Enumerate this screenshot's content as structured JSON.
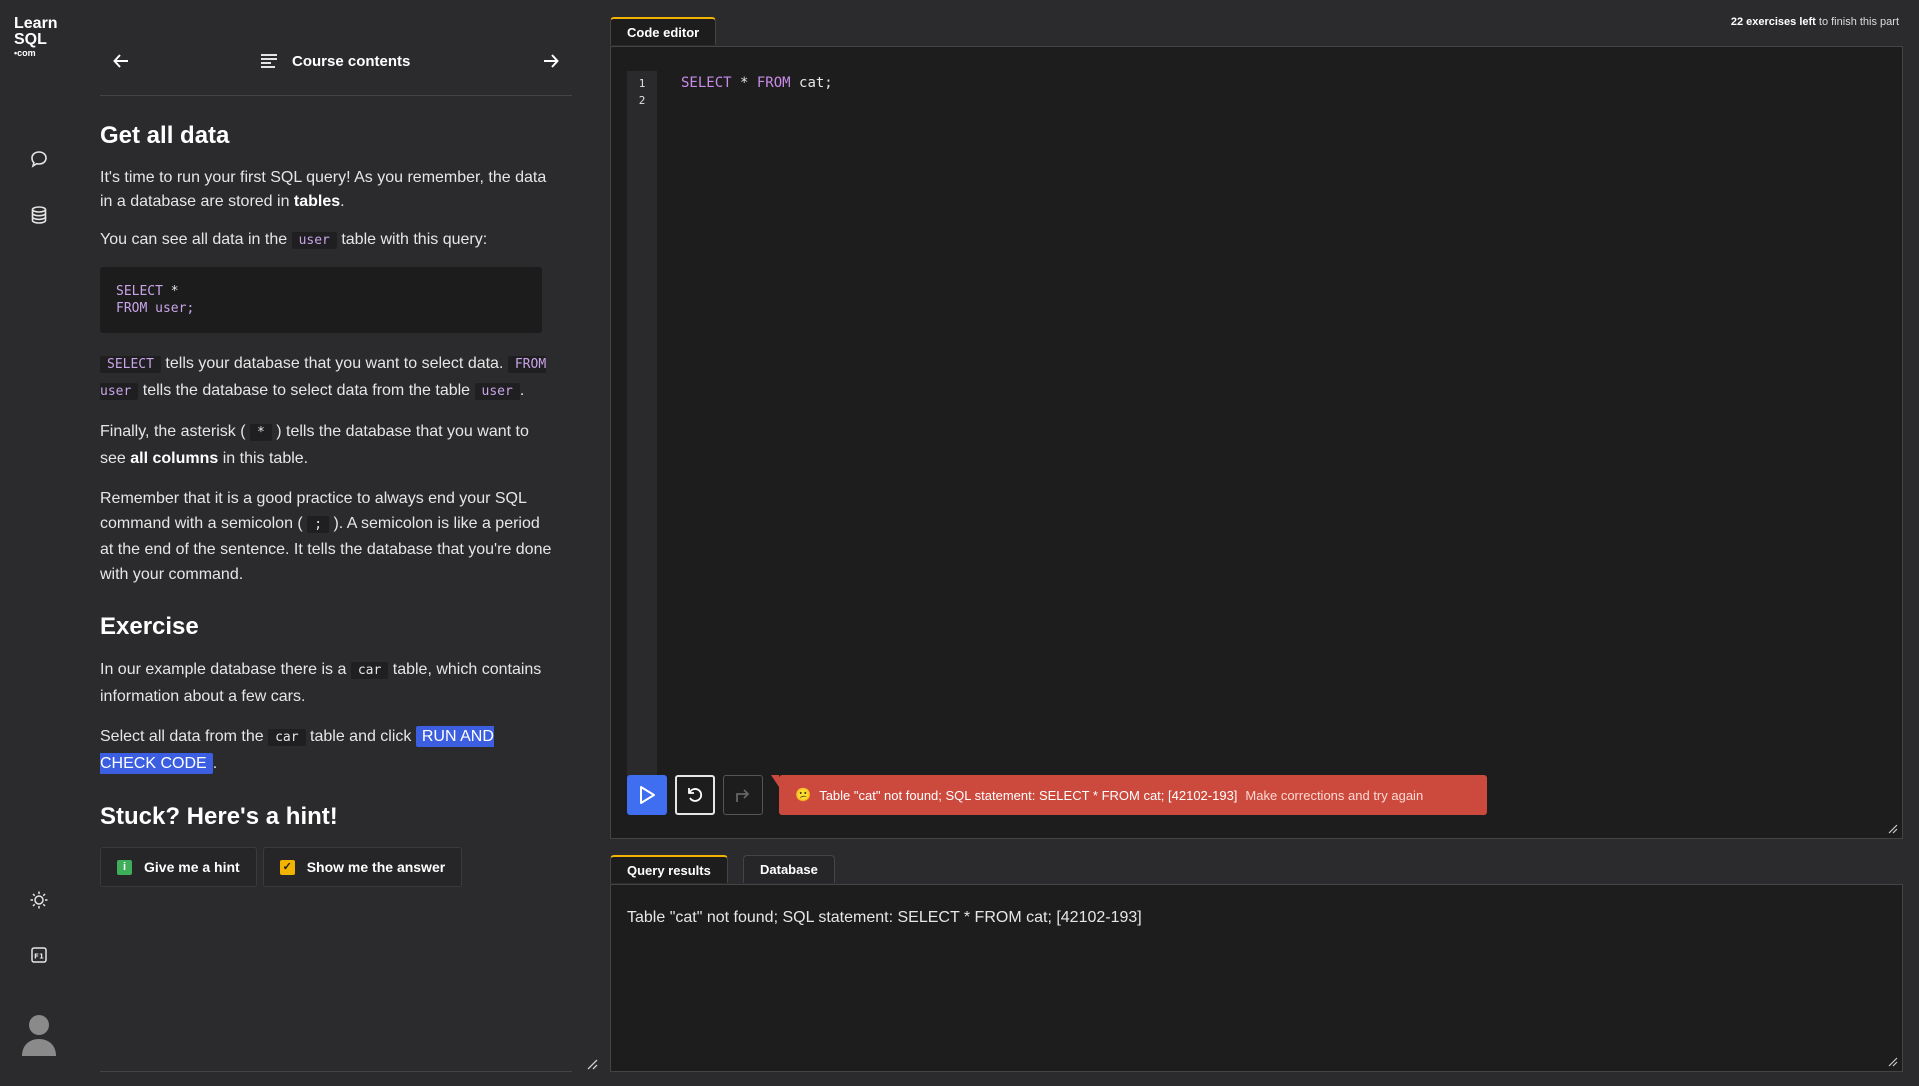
{
  "logo": {
    "line1": "Learn",
    "line2": "SQL",
    "line3": "•com"
  },
  "nav": {
    "title": "Course contents"
  },
  "lesson": {
    "title": "Get all data",
    "p1_a": "It's time to run your first SQL query! As you remember, the data in a database are stored in ",
    "p1_b": "tables",
    "p1_c": ".",
    "p2_a": "You can see all data in the ",
    "p2_code": "user",
    "p2_b": " table with this query:",
    "code_l1_kw": "SELECT",
    "code_l1_rest": " *",
    "code_l2_kw": "FROM",
    "code_l2_rest": " user;",
    "p3_code1": "SELECT",
    "p3_a": " tells your database that you want to select data. ",
    "p3_code2": "FROM user",
    "p3_b": " tells the database to select data from the table ",
    "p3_code3": "user",
    "p3_c": ".",
    "p4_a": "Finally, the asterisk ( ",
    "p4_code": "*",
    "p4_b": " ) tells the database that you want to see ",
    "p4_bold": "all columns",
    "p4_c": " in this table.",
    "p5_a": "Remember that it is a good practice to always end your SQL command with a semicolon ( ",
    "p5_code": ";",
    "p5_b": " ). A semicolon is like a period at the end of the sentence. It tells the database that you're done with your command.",
    "exercise_title": "Exercise",
    "e1_a": "In our example database there is a ",
    "e1_code": "car",
    "e1_b": " table, which contains information about a few cars.",
    "e2_a": "Select all data from the ",
    "e2_code": "car",
    "e2_b": " table and click ",
    "e2_chip": "RUN AND CHECK CODE",
    "e2_c": ".",
    "hint_title": "Stuck? Here's a hint!",
    "hint_button": "Give me a hint",
    "answer_button": "Show me the answer"
  },
  "progress": {
    "count": "22 exercises left",
    "suffix": " to finish this part"
  },
  "editor": {
    "tab": "Code editor",
    "line_numbers": [
      "1",
      "2"
    ],
    "code_kw1": "SELECT",
    "code_star": " * ",
    "code_kw2": "FROM",
    "code_rest": " cat;"
  },
  "error": {
    "icon": "😕",
    "message": "Table \"cat\" not found; SQL statement: SELECT * FROM cat; [42102-193]",
    "hint": "Make corrections and try again"
  },
  "results": {
    "tab_results": "Query results",
    "tab_database": "Database",
    "text": "Table \"cat\" not found; SQL statement: SELECT * FROM cat; [42102-193]"
  },
  "colors": {
    "accent": "#3f6ef0",
    "error": "#cc4a3d",
    "tab_active": "#f2b300",
    "keyword": "#c98be8"
  }
}
